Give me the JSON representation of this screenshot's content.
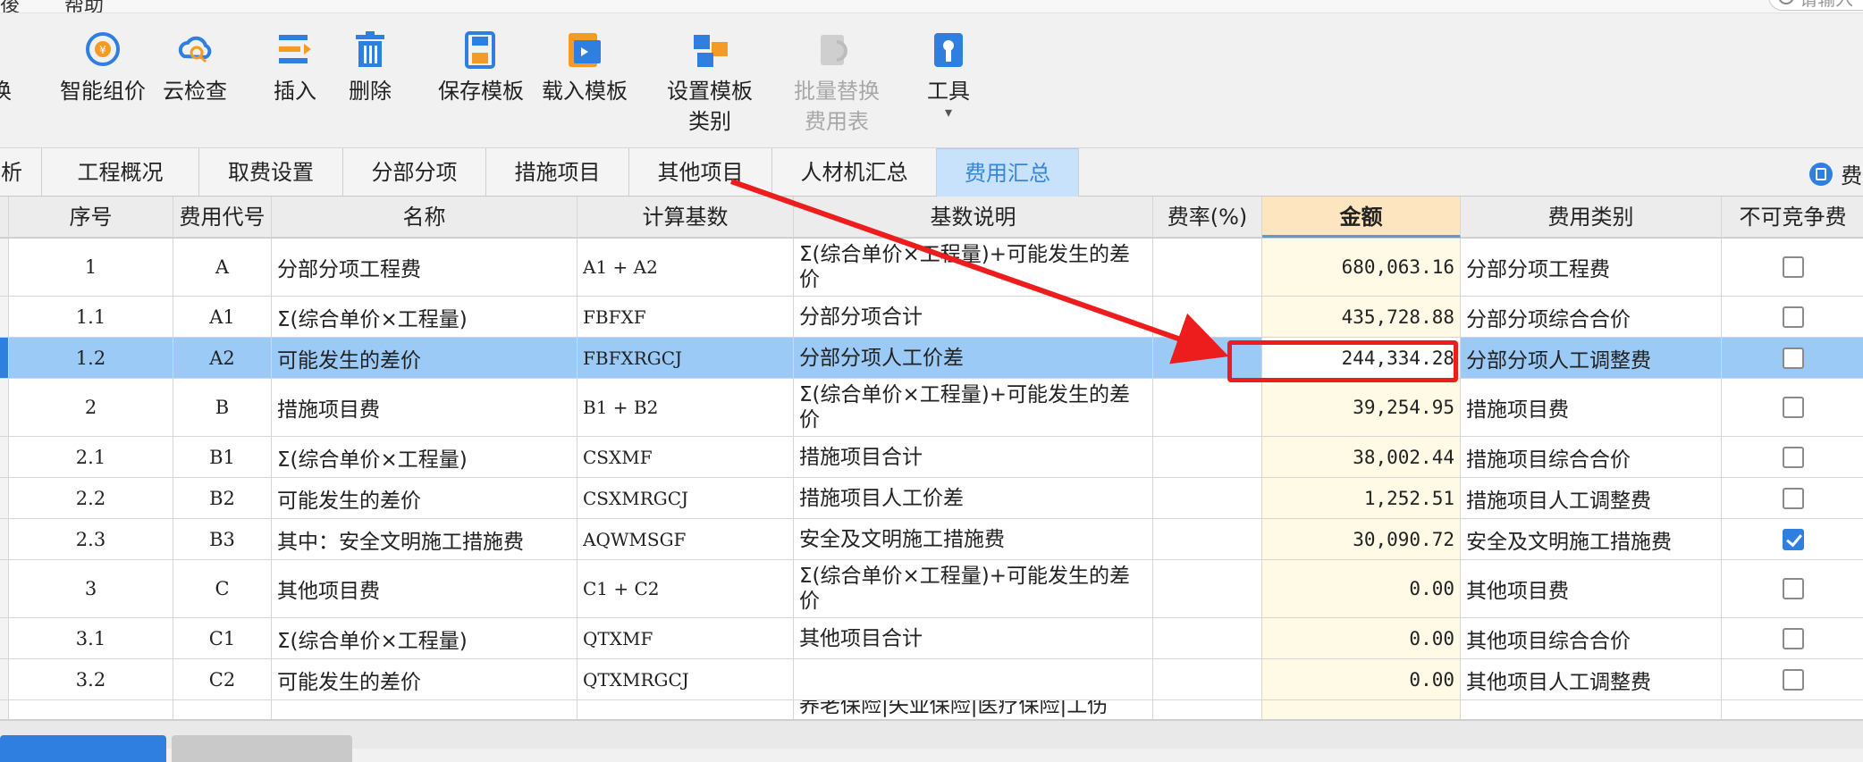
{
  "menu": {
    "items": [
      "後",
      "帮助"
    ],
    "search_placeholder": "请输入"
  },
  "toolbar": {
    "items": [
      {
        "label": "换",
        "icon": "swap-icon",
        "disabled": false
      },
      {
        "label": "智能组价",
        "icon": "smart-pricing-icon",
        "disabled": false
      },
      {
        "label": "云检查",
        "icon": "cloud-check-icon",
        "disabled": false
      },
      {
        "label": "插入",
        "icon": "insert-icon",
        "disabled": false
      },
      {
        "label": "删除",
        "icon": "trash-icon",
        "disabled": false
      },
      {
        "label": "保存模板",
        "icon": "save-template-icon",
        "disabled": false
      },
      {
        "label": "载入模板",
        "icon": "load-template-icon",
        "disabled": false
      },
      {
        "label": "设置模板\n类别",
        "icon": "template-category-icon",
        "disabled": false
      },
      {
        "label": "批量替换\n费用表",
        "icon": "batch-replace-icon",
        "disabled": true
      },
      {
        "label": "工具",
        "icon": "tools-icon",
        "disabled": false,
        "dropdown": true
      }
    ]
  },
  "tabs": {
    "items": [
      "析",
      "工程概况",
      "取费设置",
      "分部分项",
      "措施项目",
      "其他项目",
      "人材机汇总",
      "费用汇总"
    ],
    "active_index": 7,
    "right_label": "费"
  },
  "table": {
    "headers": [
      "序号",
      "费用代号",
      "名称",
      "计算基数",
      "基数说明",
      "费率(%)",
      "金额",
      "费用类别",
      "不可竞争费"
    ],
    "rows": [
      {
        "seq": "1",
        "code": "A",
        "name": "分部分项工程费",
        "base": "A1 + A2",
        "desc": "Σ(综合单价×工程量)+可能发生的差价",
        "rate": "",
        "amount": "680,063.16",
        "category": "分部分项工程费",
        "noncompete": false
      },
      {
        "seq": "1.1",
        "code": "A1",
        "name": "Σ(综合单价×工程量)",
        "base": "FBFXF",
        "desc": "分部分项合计",
        "rate": "",
        "amount": "435,728.88",
        "category": "分部分项综合合价",
        "noncompete": false
      },
      {
        "seq": "1.2",
        "code": "A2",
        "name": "可能发生的差价",
        "base": "FBFXRGCJ",
        "desc": "分部分项人工价差",
        "rate": "",
        "amount": "244,334.28",
        "category": "分部分项人工调整费",
        "noncompete": false
      },
      {
        "seq": "2",
        "code": "B",
        "name": "措施项目费",
        "base": "B1 + B2",
        "desc": "Σ(综合单价×工程量)+可能发生的差价",
        "rate": "",
        "amount": "39,254.95",
        "category": "措施项目费",
        "noncompete": false
      },
      {
        "seq": "2.1",
        "code": "B1",
        "name": "Σ(综合单价×工程量)",
        "base": "CSXMF",
        "desc": "措施项目合计",
        "rate": "",
        "amount": "38,002.44",
        "category": "措施项目综合合价",
        "noncompete": false
      },
      {
        "seq": "2.2",
        "code": "B2",
        "name": "可能发生的差价",
        "base": "CSXMRGCJ",
        "desc": "措施项目人工价差",
        "rate": "",
        "amount": "1,252.51",
        "category": "措施项目人工调整费",
        "noncompete": false
      },
      {
        "seq": "2.3",
        "code": "B3",
        "name": "其中：安全文明施工措施费",
        "base": "AQWMSGF",
        "desc": "安全及文明施工措施费",
        "rate": "",
        "amount": "30,090.72",
        "category": "安全及文明施工措施费",
        "noncompete": true
      },
      {
        "seq": "3",
        "code": "C",
        "name": "其他项目费",
        "base": "C1 + C2",
        "desc": "Σ(综合单价×工程量)+可能发生的差价",
        "rate": "",
        "amount": "0.00",
        "category": "其他项目费",
        "noncompete": false
      },
      {
        "seq": "3.1",
        "code": "C1",
        "name": "Σ(综合单价×工程量)",
        "base": "QTXMF",
        "desc": "其他项目合计",
        "rate": "",
        "amount": "0.00",
        "category": "其他项目综合合价",
        "noncompete": false
      },
      {
        "seq": "3.2",
        "code": "C2",
        "name": "可能发生的差价",
        "base": "QTXMRGCJ",
        "desc": "",
        "rate": "",
        "amount": "0.00",
        "category": "其他项目人工调整费",
        "noncompete": false
      },
      {
        "seq": "",
        "code": "",
        "name": "",
        "base": "",
        "desc": "养老保险|失业保险|医疗保险|工伤",
        "rate": "",
        "amount": "",
        "category": "",
        "noncompete": null
      }
    ],
    "selected_index": 2
  },
  "colors": {
    "accent": "#2f7fe0",
    "selected_row": "#9bcaf6",
    "amount_header": "#fde6bf",
    "annotation": "#ee1d1d"
  }
}
